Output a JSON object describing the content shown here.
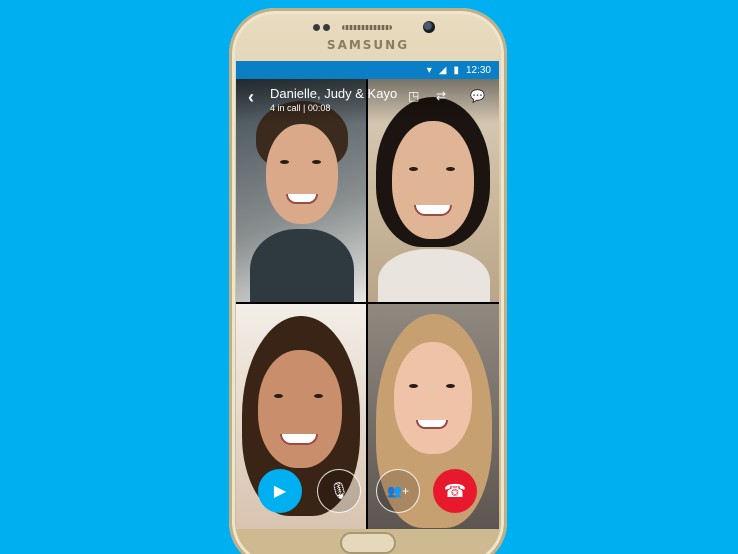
{
  "device": {
    "brand": "SAMSUNG"
  },
  "statusbar": {
    "time": "12:30",
    "wifi_icon": "wifi-icon",
    "signal_icon": "signal-icon",
    "battery_icon": "battery-icon"
  },
  "call": {
    "title": "Danielle, Judy & Kayo",
    "subtitle": "4 in call  |  00:08",
    "back_icon": "back-chevron-icon",
    "pip_icon": "picture-in-picture-icon",
    "switch_camera_icon": "switch-camera-icon",
    "chat_icon": "chat-icon"
  },
  "participants": [
    {
      "tile": "participant-video-1"
    },
    {
      "tile": "participant-video-2"
    },
    {
      "tile": "participant-video-3"
    },
    {
      "tile": "participant-video-4"
    }
  ],
  "controls": {
    "video_icon": "video-camera-icon",
    "mic_icon": "microphone-icon",
    "add_icon": "add-people-icon",
    "end_icon": "end-call-icon",
    "end_color": "#e8192c",
    "video_color": "#00aff0"
  },
  "colors": {
    "background": "#00aff0",
    "statusbar": "#0a7fc6"
  }
}
